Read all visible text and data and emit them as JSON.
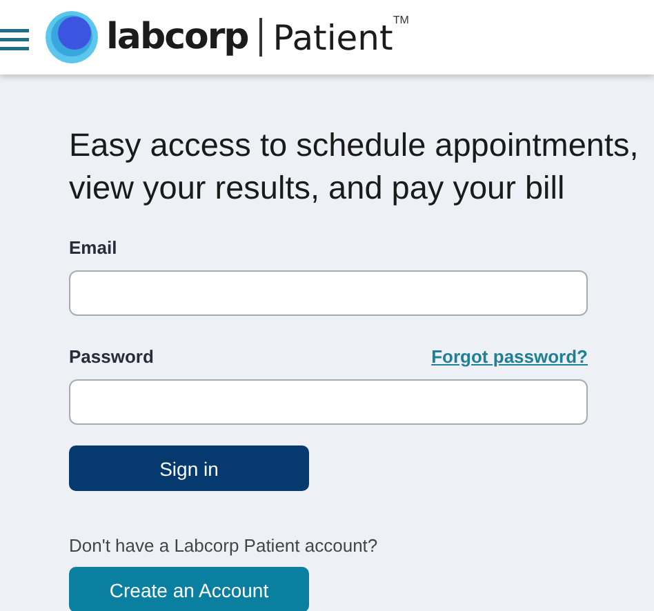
{
  "header": {
    "brand": "labcorp",
    "product": "Patient",
    "trademark": "TM"
  },
  "heading": "Easy access to schedule appointments, view your results, and pay your bill",
  "email": {
    "label": "Email"
  },
  "password": {
    "label": "Password",
    "forgot_link": "Forgot password?"
  },
  "sign_in_button": "Sign in",
  "signup_prompt": "Don't have a Labcorp Patient account?",
  "create_account_button": "Create an Account"
}
